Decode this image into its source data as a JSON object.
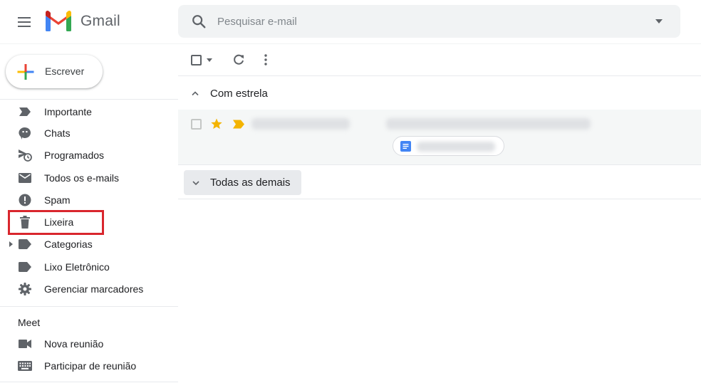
{
  "app": {
    "logo_text": "Gmail"
  },
  "search": {
    "placeholder": "Pesquisar e-mail"
  },
  "compose": {
    "label": "Escrever"
  },
  "sidebar": {
    "items": [
      {
        "label": "Importante",
        "icon": "label-important-icon"
      },
      {
        "label": "Chats",
        "icon": "chat-icon"
      },
      {
        "label": "Programados",
        "icon": "scheduled-icon"
      },
      {
        "label": "Todos os e-mails",
        "icon": "mail-icon"
      },
      {
        "label": "Spam",
        "icon": "spam-icon"
      },
      {
        "label": "Lixeira",
        "icon": "trash-icon"
      },
      {
        "label": "Categorias",
        "icon": "label-icon"
      },
      {
        "label": "Lixo Eletrônico",
        "icon": "label-icon"
      },
      {
        "label": "Gerenciar marcadores",
        "icon": "gear-icon"
      }
    ],
    "meet": {
      "title": "Meet",
      "items": [
        {
          "label": "Nova reunião",
          "icon": "video-icon"
        },
        {
          "label": "Participar de reunião",
          "icon": "keyboard-icon"
        }
      ]
    }
  },
  "main": {
    "sections": {
      "starred": "Com estrela",
      "others": "Todas as demais"
    }
  },
  "colors": {
    "highlight": "#d9262d",
    "star": "#f4b400",
    "icon_gray": "#5f6368",
    "search_bg": "#f1f3f4"
  }
}
